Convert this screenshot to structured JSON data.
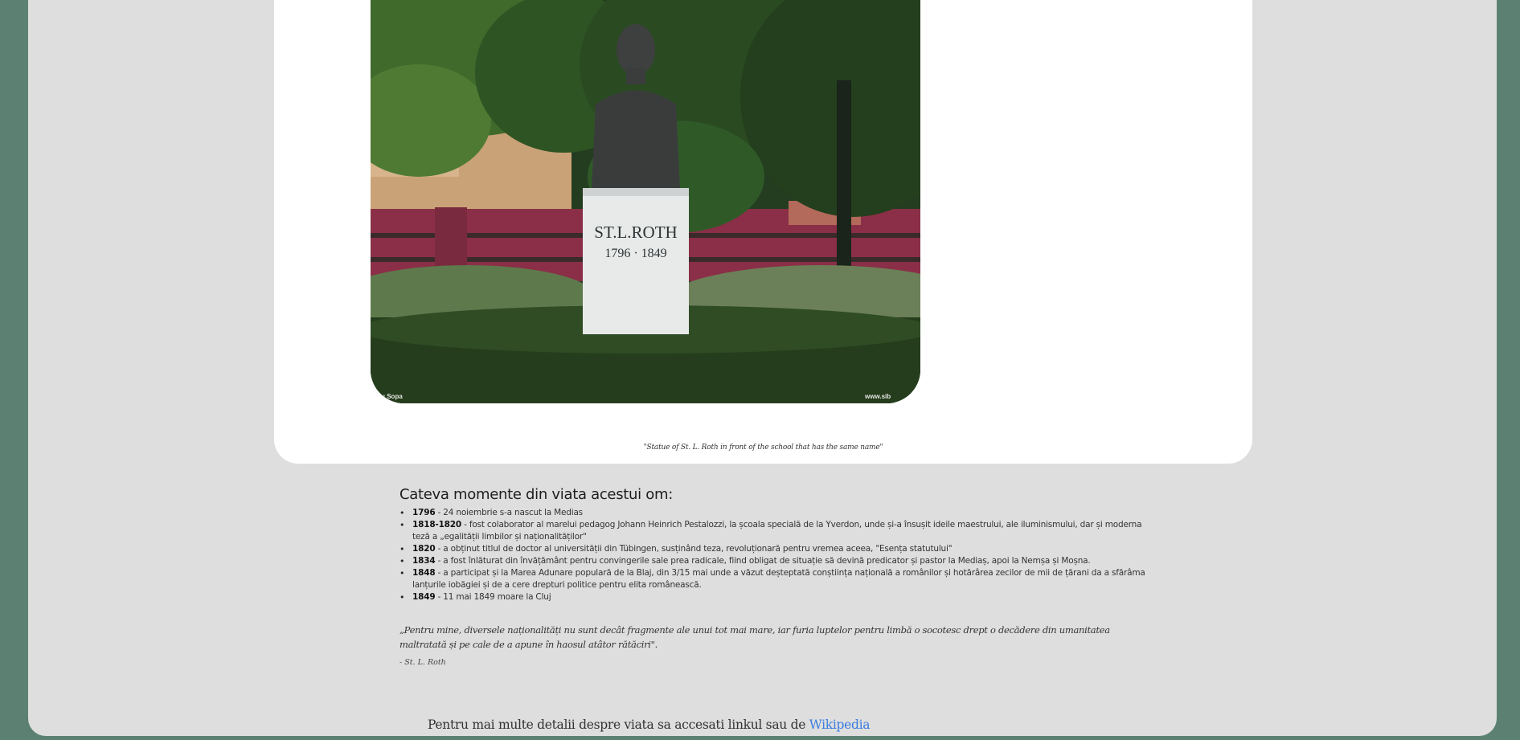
{
  "image": {
    "plinth_name": "ST.L.ROTH",
    "plinth_years": "1796 · 1849",
    "watermark_left": "diu Sopa",
    "watermark_right": "www.sib",
    "caption": "\"Statue of St. L. Roth in front of the school that has the same name\""
  },
  "moments": {
    "heading": "Cateva momente din viata acestui om:",
    "items": [
      {
        "year": "1796",
        "text": " - 24 noiembrie s-a nascut la Medias"
      },
      {
        "year": "1818-1820",
        "text": " - fost colaborator al marelui pedagog Johann Heinrich Pestalozzi, la școala specială de la Yverdon, unde și-a însușit ideile maestrului, ale iluminismului, dar și moderna teză a „egalității limbilor și naționalităților\""
      },
      {
        "year": "1820",
        "text": " - a obținut titlul de doctor al universității din Tübingen, susținând teza, revoluționară pentru vremea aceea, \"Esența statutului\""
      },
      {
        "year": "1834",
        "text": " - a fost înlăturat din învățământ pentru convingerile sale prea radicale, fiind obligat de situație să devină predicator și pastor la Mediaș, apoi la Nemșa și Moșna."
      },
      {
        "year": "1848",
        "text": " - a participat și la Marea Adunare populară de la Blaj, din 3/15 mai unde a văzut deșteptată conștiința națională a românilor și hotărârea zecilor de mii de țărani da a sfărâma lanțurile iobăgiei și de a cere drepturi politice pentru elita românească."
      },
      {
        "year": "1849",
        "text": " - 11 mai 1849 moare la Cluj"
      }
    ]
  },
  "quote": {
    "text": "„Pentru mine, diversele naționalități nu sunt decât fragmente ale unui tot mai mare, iar furia luptelor pentru limbă o socotesc drept o decădere din umanitatea maltratată și pe cale de a apune în haosul atâtor rătăciri\".",
    "author": "- St. L. Roth"
  },
  "footer": {
    "text": "Pentru mai multe detalii despre viata sa accesati linkul sau de ",
    "link_label": "Wikipedia"
  }
}
